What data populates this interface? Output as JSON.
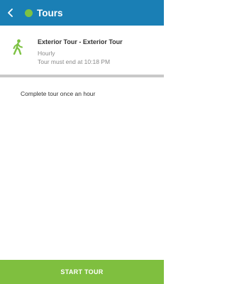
{
  "header": {
    "title": "Tours",
    "back_icon": "chevron-left-icon",
    "status_color": "#7dc243",
    "bar_color": "#1a7fb5"
  },
  "tour": {
    "name": "Exterior Tour - Exterior Tour",
    "frequency": "Hourly",
    "end_notice": "Tour must end at 10:18 PM",
    "icon": "walking-person-icon",
    "icon_color": "#7dc243"
  },
  "details": {
    "instructions": "Complete tour once an hour"
  },
  "footer": {
    "start_label": "START TOUR",
    "button_color": "#7fbf3f"
  }
}
